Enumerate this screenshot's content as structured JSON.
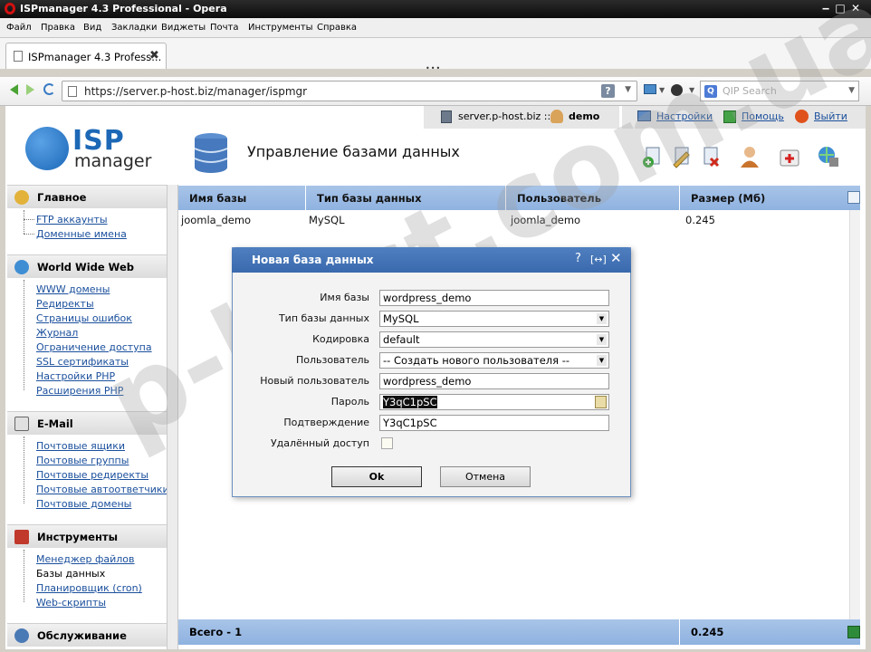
{
  "window": {
    "title": "ISPmanager 4.3 Professional - Opera"
  },
  "menu": [
    "Файл",
    "Правка",
    "Вид",
    "Закладки",
    "Виджеты",
    "Почта",
    "Инструменты",
    "Справка"
  ],
  "tab": {
    "label": "ISPmanager 4.3 Profess..."
  },
  "address": {
    "url": "https://server.p-host.biz/manager/ispmgr",
    "help": "?"
  },
  "search": {
    "placeholder": "QIP Search"
  },
  "topinfo": {
    "server": "server.p-host.biz ::",
    "user": "demo"
  },
  "topnav": {
    "settings": "Настройки",
    "help": "Помощь",
    "logout": "Выйти"
  },
  "logo": {
    "isp": "ISP",
    "manager": "manager"
  },
  "page_title": "Управление базами данных",
  "sidebar": {
    "sections": [
      {
        "title": "Главное",
        "items": [
          "FTP аккаунты",
          "Доменные имена"
        ]
      },
      {
        "title": "World Wide Web",
        "items": [
          "WWW домены",
          "Редиректы",
          "Страницы ошибок",
          "Журнал",
          "Ограничение доступа",
          "SSL сертификаты",
          "Настройки PHP",
          "Расширения PHP"
        ]
      },
      {
        "title": "E-Mail",
        "items": [
          "Почтовые ящики",
          "Почтовые группы",
          "Почтовые редиректы",
          "Почтовые автоответчики",
          "Почтовые домены"
        ]
      },
      {
        "title": "Инструменты",
        "items": [
          "Менеджер файлов",
          "Базы данных",
          "Планировщик (cron)",
          "Web-скрипты"
        ]
      },
      {
        "title": "Обслуживание",
        "items": []
      }
    ]
  },
  "table": {
    "columns": [
      "Имя базы",
      "Тип базы данных",
      "Пользователь",
      "Размер (Мб)"
    ],
    "rows": [
      [
        "joomla_demo",
        "MySQL",
        "joomla_demo",
        "0.245"
      ]
    ],
    "footer": {
      "label": "Всего - 1",
      "size": "0.245"
    }
  },
  "dialog": {
    "title": "Новая база данных",
    "fields": {
      "db_name": {
        "label": "Имя базы",
        "value": "wordpress_demo"
      },
      "db_type": {
        "label": "Тип базы данных",
        "value": "MySQL"
      },
      "encoding": {
        "label": "Кодировка",
        "value": "default"
      },
      "user": {
        "label": "Пользователь",
        "value": "-- Создать нового пользователя --"
      },
      "new_user": {
        "label": "Новый пользователь",
        "value": "wordpress_demo"
      },
      "password": {
        "label": "Пароль",
        "value": "Y3qC1pSC"
      },
      "confirm": {
        "label": "Подтверждение",
        "value": "Y3qC1pSC"
      },
      "remote": {
        "label": "Удалённый доступ",
        "checked": false
      }
    },
    "ok": "Ok",
    "cancel": "Отмена"
  },
  "watermark": "p-host.com.ua"
}
